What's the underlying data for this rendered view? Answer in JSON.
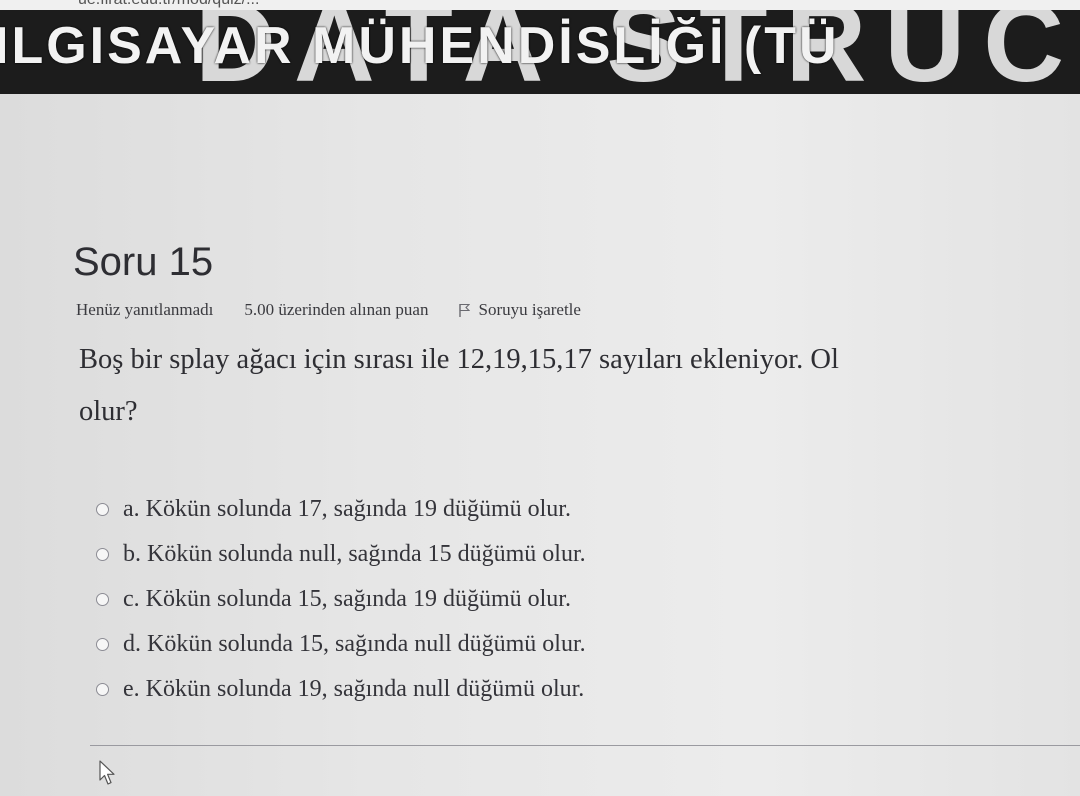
{
  "browser": {
    "url": "ue.firat.edu.tr/mod/quiz/..."
  },
  "banner": {
    "department_text": "ILGISAYAR MÜHENDİSLİĞİ (TÜ",
    "course_text": "DATA STRUCTU"
  },
  "question": {
    "title": "Soru 15",
    "status": "Henüz yanıtlanmadı",
    "points": "5.00 üzerinden alınan puan",
    "flag_label": "Soruyu işaretle",
    "text_line1": "Boş bir splay ağacı için sırası ile 12,19,15,17 sayıları ekleniyor. Ol",
    "text_line2": "olur?"
  },
  "answers": [
    {
      "label": "a. Kökün solunda 17, sağında 19 düğümü olur.",
      "selected": false
    },
    {
      "label": "b. Kökün solunda null, sağında 15 düğümü olur.",
      "selected": false
    },
    {
      "label": "c. Kökün solunda 15, sağında 19 düğümü olur.",
      "selected": false
    },
    {
      "label": "d. Kökün solunda 15, sağında null düğümü olur.",
      "selected": false
    },
    {
      "label": "e. Kökün solunda 19, sağında null düğümü olur.",
      "selected": false
    }
  ],
  "colors": {
    "banner_bg": "#1c1c1c",
    "text": "#2e2e33",
    "page_bg": "#e6e6e6"
  }
}
